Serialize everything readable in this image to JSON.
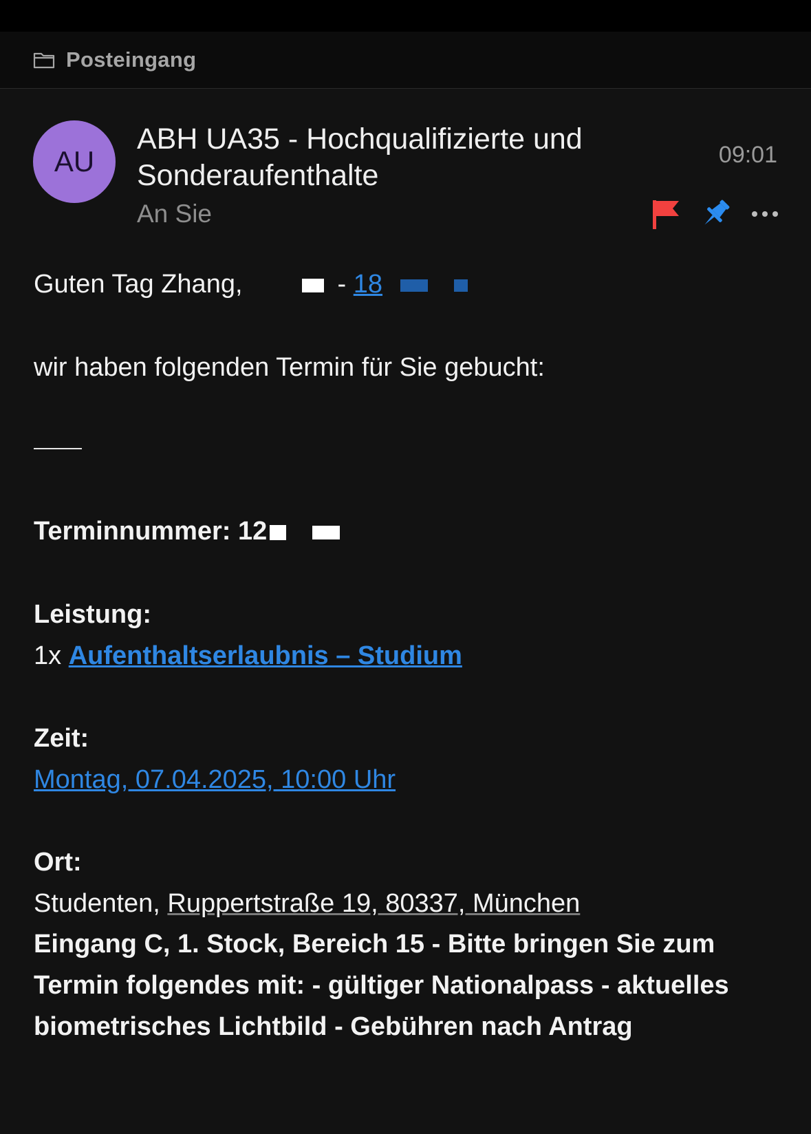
{
  "nav": {
    "folder_label": "Posteingang",
    "folder_icon": "folder-icon"
  },
  "message": {
    "avatar_initials": "AU",
    "avatar_color": "#9c72d9",
    "sender": "ABH UA35 - Hochqualifizierte und Sonderaufenthalte",
    "recipient": "An Sie",
    "time": "09:01",
    "actions": [
      {
        "icon": "flag-icon",
        "color": "#f2413f"
      },
      {
        "icon": "pin-icon",
        "color": "#2b8cf0"
      },
      {
        "icon": "more-icon",
        "color": "#bdbdbd"
      }
    ]
  },
  "body": {
    "greeting": "Guten Tag Zhang,",
    "greeting_dash": "-",
    "greeting_link": "18",
    "intro": "wir haben folgenden Termin für Sie gebucht:",
    "booking_label": "Terminnummer:",
    "booking_number": "12",
    "service_label": "Leistung:",
    "service_qty": "1x",
    "service_link": "Aufenthaltserlaubnis – Studium",
    "time_label": "Zeit:",
    "time_link": "Montag, 07.04.2025, 10:00 Uhr",
    "place_label": "Ort:",
    "place_name": "Studenten,",
    "place_address": "Ruppertstraße 19, 80337, München",
    "instructions": "Eingang C, 1. Stock, Bereich 15 - Bitte bringen Sie zum Termin folgendes mit: - gültiger Nationalpass - aktuelles biometrisches Lichtbild - Gebühren nach Antrag"
  },
  "colors": {
    "background": "#121212",
    "link": "#2f87e3",
    "text": "#f2f2f2",
    "muted": "#8e8e8e"
  }
}
